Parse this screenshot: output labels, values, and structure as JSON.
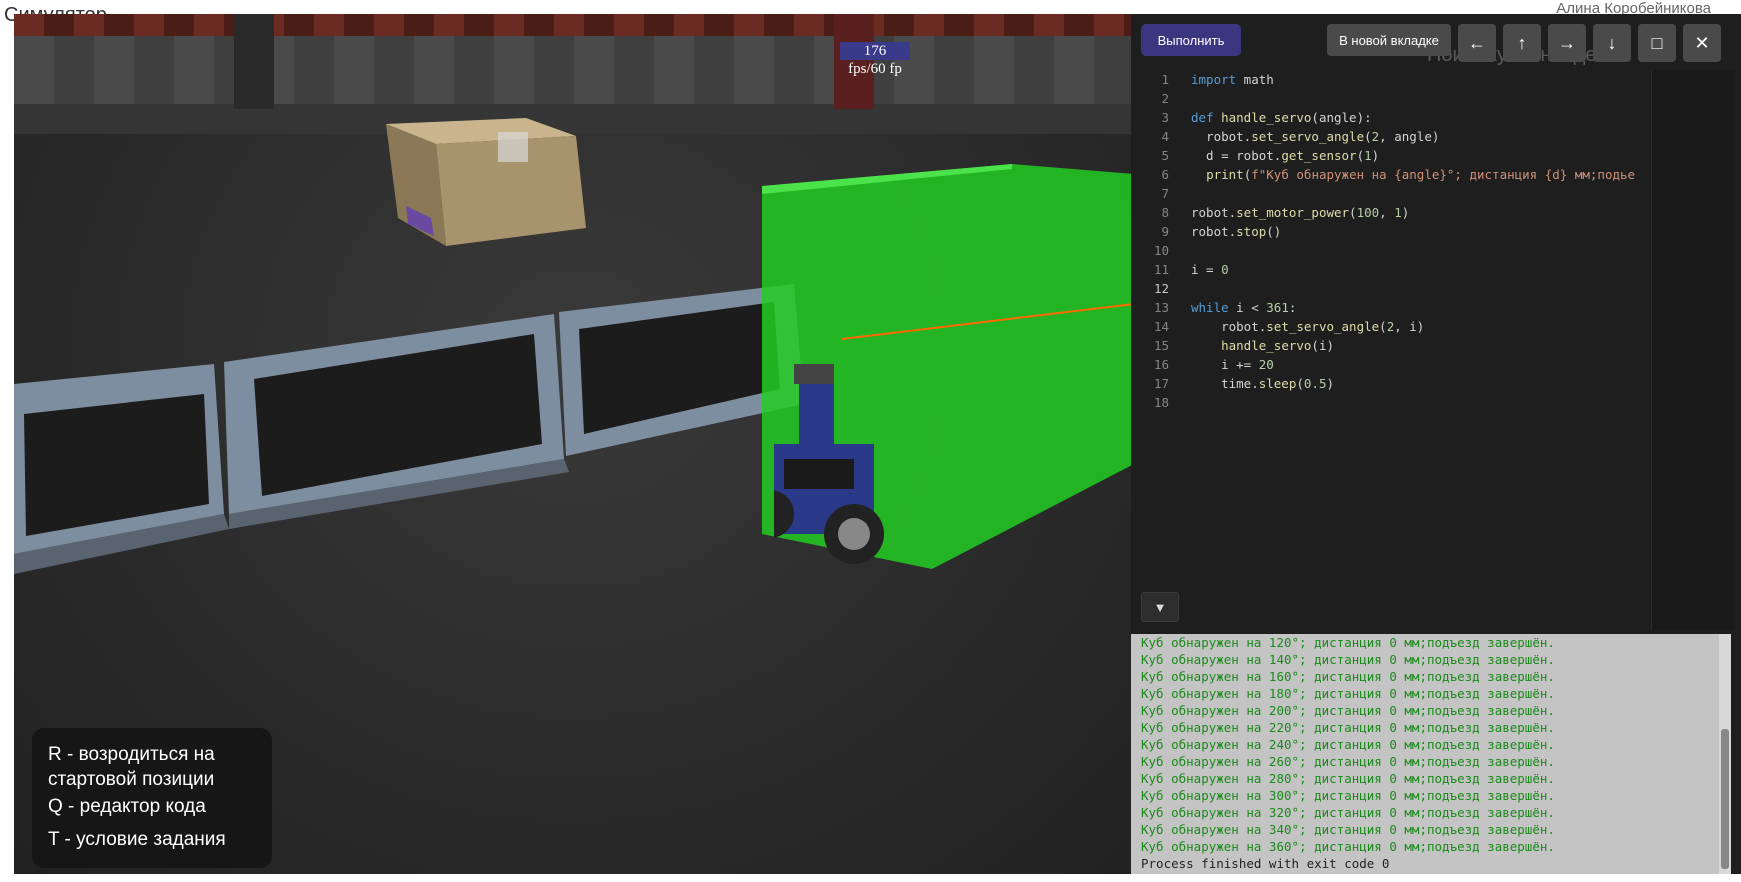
{
  "page": {
    "title": "Симулятор",
    "user": "Алина Коробейникова"
  },
  "viewport": {
    "fps_value": "176",
    "fps_label": "fps/60 fp",
    "hints": [
      "R - возродиться на стартовой позиции",
      "Q - редактор кода",
      "T - условие задания"
    ],
    "status_text": "Поиск куба: найден!"
  },
  "toolbar": {
    "run_label": "Выполнить",
    "newtab_label": "В новой вкладке",
    "left_arrow": "←",
    "up_arrow": "↑",
    "right_arrow": "→",
    "down_arrow": "↓",
    "maximize": "□",
    "close": "✕"
  },
  "editor": {
    "active_line": 12,
    "lines": [
      "import math",
      "",
      "def handle_servo(angle):",
      "  robot.set_servo_angle(2, angle)",
      "  d = robot.get_sensor(1)",
      "  print(f\"Куб обнаружен на {angle}°; дистанция {d} мм;подье",
      "",
      "robot.set_motor_power(100, 1)",
      "robot.stop()",
      "",
      "i = 0",
      "",
      "while i < 361:",
      "    robot.set_servo_angle(2, i)",
      "    handle_servo(i)",
      "    i += 20",
      "    time.sleep(0.5)",
      ""
    ],
    "collapse_glyph": "▼"
  },
  "console": {
    "lines": [
      "Куб обнаружен на 120°; дистанция 0 мм;подъезд завершён.",
      "Куб обнаружен на 140°; дистанция 0 мм;подъезд завершён.",
      "Куб обнаружен на 160°; дистанция 0 мм;подъезд завершён.",
      "Куб обнаружен на 180°; дистанция 0 мм;подъезд завершён.",
      "Куб обнаружен на 200°; дистанция 0 мм;подъезд завершён.",
      "Куб обнаружен на 220°; дистанция 0 мм;подъезд завершён.",
      "Куб обнаружен на 240°; дистанция 0 мм;подъезд завершён.",
      "Куб обнаружен на 260°; дистанция 0 мм;подъезд завершён.",
      "Куб обнаружен на 280°; дистанция 0 мм;подъезд завершён.",
      "Куб обнаружен на 300°; дистанция 0 мм;подъезд завершён.",
      "Куб обнаружен на 320°; дистанция 0 мм;подъезд завершён.",
      "Куб обнаружен на 340°; дистанция 0 мм;подъезд завершён.",
      "Куб обнаружен на 360°; дистанция 0 мм;подъезд завершён."
    ],
    "final_line": "Process finished with exit code 0"
  },
  "colors": {
    "run_button": "#3b3680",
    "console_text": "#1a8a1a",
    "cube": "#22cc22"
  }
}
